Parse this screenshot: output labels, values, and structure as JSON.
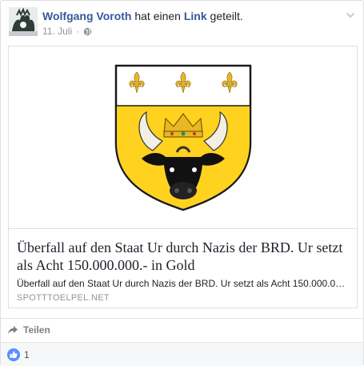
{
  "post": {
    "author": "Wolfgang Voroth",
    "action_text": "hat einen",
    "link_word": "Link",
    "action_suffix": "geteilt.",
    "date": "11. Juli",
    "separator": "·"
  },
  "link_card": {
    "title": "Überfall auf den Staat Ur durch Nazis der BRD. Ur setzt als Acht 150.000.000.- in Gold",
    "description": "Überfall auf den Staat Ur durch Nazis der BRD. Ur setzt als Acht 150.000.000.- in...",
    "domain": "SPOTTTOELPEL.NET"
  },
  "actions": {
    "share_label": "Teilen"
  },
  "reactions": {
    "like_count": "1"
  },
  "colors": {
    "link_blue": "#365899",
    "like_blue": "#5890ff",
    "shield_yellow": "#ffd21f",
    "meta_gray": "#90949c"
  },
  "icons": {
    "avatar": "heraldic-crest-avatar",
    "privacy": "globe-icon",
    "menu": "chevron-down-icon",
    "share": "share-arrow-icon",
    "like": "thumbs-up-icon"
  }
}
